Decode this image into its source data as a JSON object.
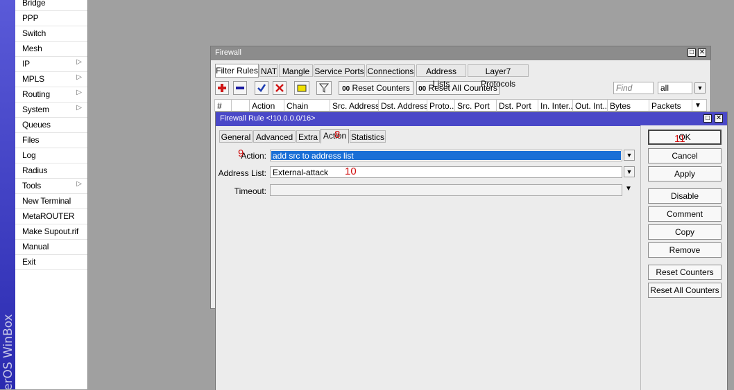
{
  "brand": {
    "vertical_text": "erOS WinBox"
  },
  "menu": {
    "items": [
      {
        "label": "Bridge",
        "submenu": false
      },
      {
        "label": "PPP",
        "submenu": false
      },
      {
        "label": "Switch",
        "submenu": false
      },
      {
        "label": "Mesh",
        "submenu": false
      },
      {
        "label": "IP",
        "submenu": true
      },
      {
        "label": "MPLS",
        "submenu": true
      },
      {
        "label": "Routing",
        "submenu": true
      },
      {
        "label": "System",
        "submenu": true
      },
      {
        "label": "Queues",
        "submenu": false
      },
      {
        "label": "Files",
        "submenu": false
      },
      {
        "label": "Log",
        "submenu": false
      },
      {
        "label": "Radius",
        "submenu": false
      },
      {
        "label": "Tools",
        "submenu": true
      },
      {
        "label": "New Terminal",
        "submenu": false
      },
      {
        "label": "MetaROUTER",
        "submenu": false
      },
      {
        "label": "Make Supout.rif",
        "submenu": false
      },
      {
        "label": "Manual",
        "submenu": false
      },
      {
        "label": "Exit",
        "submenu": false
      }
    ],
    "arrow_glyph": "▷"
  },
  "firewall": {
    "title": "Firewall",
    "tabs": [
      "Filter Rules",
      "NAT",
      "Mangle",
      "Service Ports",
      "Connections",
      "Address Lists",
      "Layer7 Protocols"
    ],
    "toolbar": {
      "reset_counters": "Reset Counters",
      "reset_all_counters": "Reset All Counters",
      "counter_glyph": "00",
      "find_placeholder": "Find",
      "filter_value": "all"
    },
    "columns": [
      "#",
      "",
      "Action",
      "Chain",
      "Src. Address",
      "Dst. Address",
      "Proto...",
      "Src. Port",
      "Dst. Port",
      "In. Inter...",
      "Out. Int...",
      "Bytes",
      "Packets"
    ]
  },
  "rule": {
    "title": "Firewall Rule <!10.0.0.0/16>",
    "tabs": [
      "General",
      "Advanced",
      "Extra",
      "Action",
      "Statistics"
    ],
    "action_label": "Action:",
    "action_value": "add src to address list",
    "address_list_label": "Address List:",
    "address_list_value": "External-attack",
    "timeout_label": "Timeout:",
    "timeout_value": "",
    "buttons": [
      "OK",
      "Cancel",
      "Apply",
      "Disable",
      "Comment",
      "Copy",
      "Remove",
      "Reset Counters",
      "Reset All Counters"
    ]
  },
  "annotations": {
    "n8": "8",
    "n9": "9",
    "n10": "10",
    "n11": "11"
  },
  "colors": {
    "title_active": "#4a48c8",
    "title_inactive": "#8c8c8c",
    "selection": "#1a6fd6",
    "annotation": "#d01010"
  }
}
